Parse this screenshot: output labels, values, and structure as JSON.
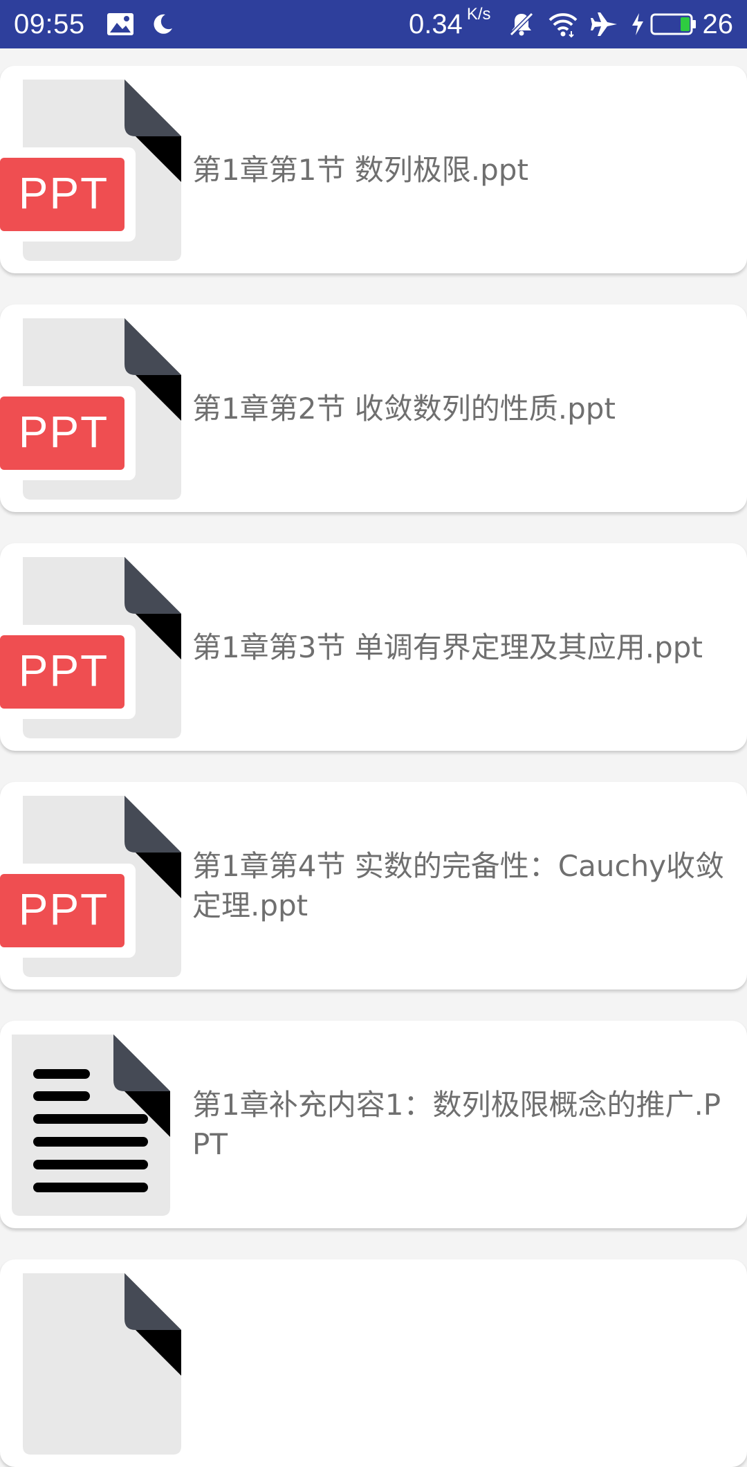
{
  "status_bar": {
    "time": "09:55",
    "net_speed": "0.34",
    "net_speed_unit": "K/s",
    "battery_level": "26",
    "icons": [
      "image-notification-icon",
      "moon-icon",
      "mute-icon",
      "wifi-icon",
      "airplane-mode-icon",
      "charging-icon",
      "battery-icon"
    ],
    "colors": {
      "background": "#2e3f9c",
      "battery_fill": "#2ecc40"
    }
  },
  "files": [
    {
      "name": "第1章第1节 数列极限.ppt",
      "icon": "ppt-file-icon",
      "badge": "PPT"
    },
    {
      "name": "第1章第2节 收敛数列的性质.ppt",
      "icon": "ppt-file-icon",
      "badge": "PPT"
    },
    {
      "name": "第1章第3节 单调有界定理及其应用.ppt",
      "icon": "ppt-file-icon",
      "badge": "PPT"
    },
    {
      "name": "第1章第4节 实数的完备性：Cauchy收敛定理.ppt",
      "icon": "ppt-file-icon",
      "badge": "PPT"
    },
    {
      "name": "第1章补充内容1：数列极限概念的推广.PPT",
      "icon": "text-document-icon"
    },
    {
      "name": "",
      "icon": "ppt-file-icon"
    }
  ],
  "colors": {
    "page_background": "#f4f4f4",
    "card_background": "#ffffff",
    "ppt_badge": "#ef4e51",
    "file_page": "#e8e8e8",
    "file_fold": "#454a55",
    "title_text": "#6f6f6f"
  }
}
